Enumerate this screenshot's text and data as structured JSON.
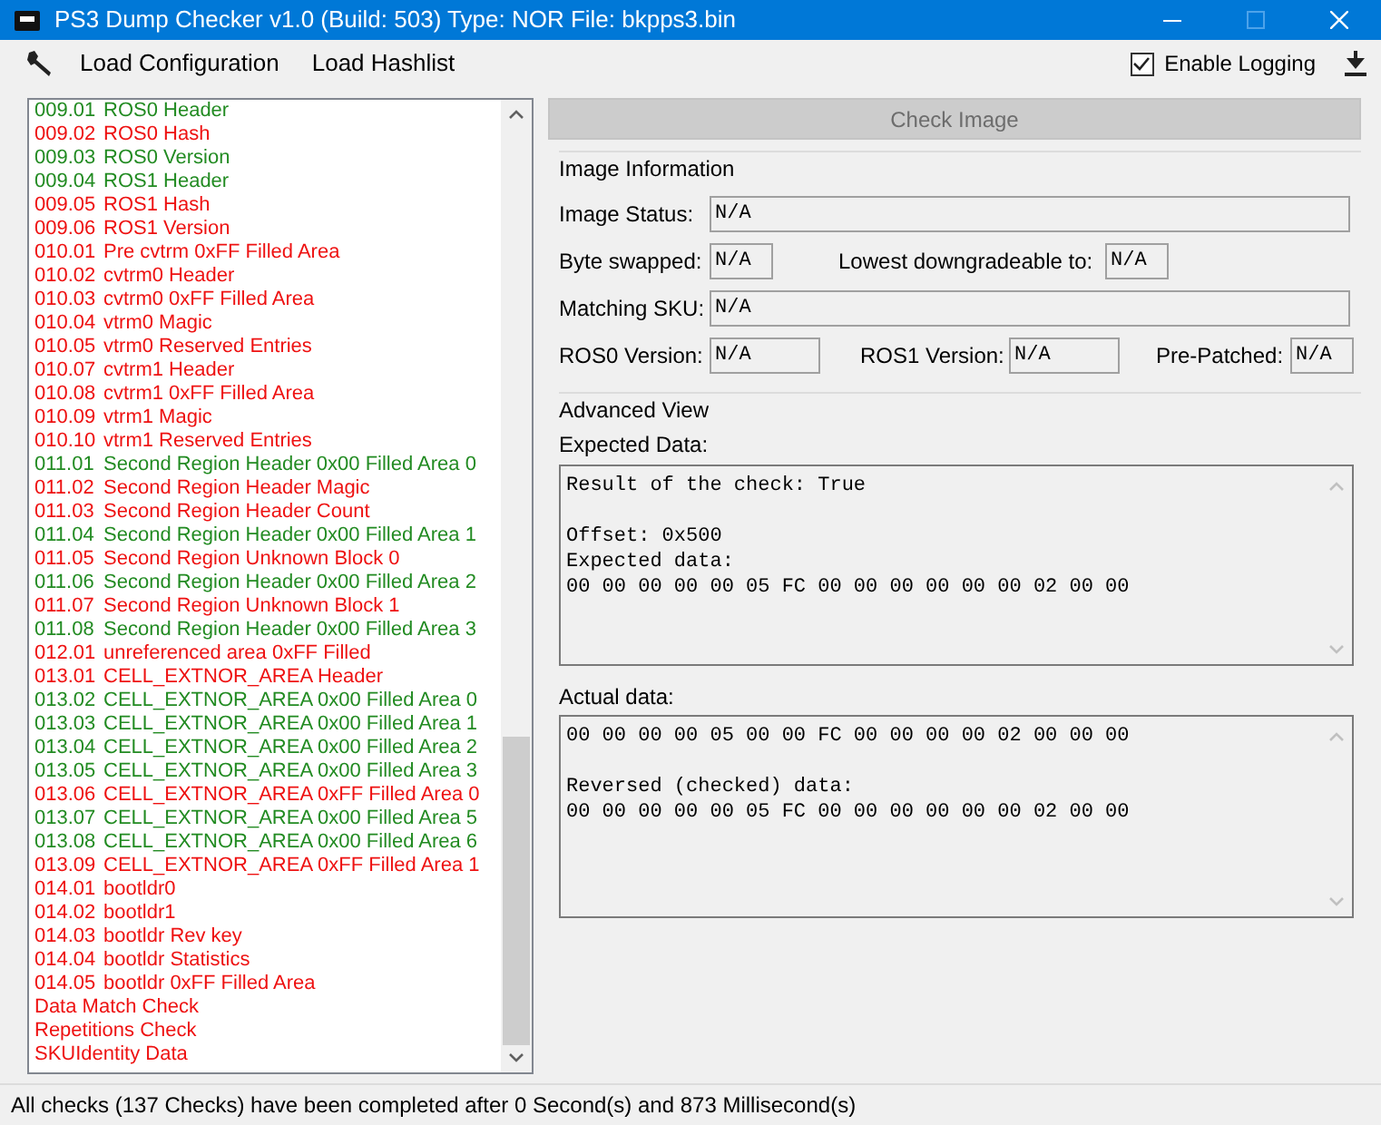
{
  "window": {
    "title": "PS3 Dump Checker v1.0 (Build: 503) Type: NOR File: bkpps3.bin"
  },
  "toolbar": {
    "items": [
      "Load Configuration",
      "Load Hashlist"
    ],
    "logging": {
      "label": "Enable Logging",
      "checked": true
    }
  },
  "checks": [
    {
      "code": "009.01",
      "label": "ROS0 Header",
      "color": "#228b22"
    },
    {
      "code": "009.02",
      "label": "ROS0 Hash",
      "color": "#ee1111"
    },
    {
      "code": "009.03",
      "label": "ROS0 Version",
      "color": "#228b22"
    },
    {
      "code": "009.04",
      "label": "ROS1 Header",
      "color": "#228b22"
    },
    {
      "code": "009.05",
      "label": "ROS1 Hash",
      "color": "#ee1111"
    },
    {
      "code": "009.06",
      "label": "ROS1 Version",
      "color": "#ee1111"
    },
    {
      "code": "010.01",
      "label": "Pre cvtrm 0xFF Filled Area",
      "color": "#ee1111"
    },
    {
      "code": "010.02",
      "label": "cvtrm0 Header",
      "color": "#ee1111"
    },
    {
      "code": "010.03",
      "label": "cvtrm0 0xFF Filled Area",
      "color": "#ee1111"
    },
    {
      "code": "010.04",
      "label": "vtrm0 Magic",
      "color": "#ee1111"
    },
    {
      "code": "010.05",
      "label": "vtrm0 Reserved Entries",
      "color": "#ee1111"
    },
    {
      "code": "010.07",
      "label": "cvtrm1 Header",
      "color": "#ee1111"
    },
    {
      "code": "010.08",
      "label": "cvtrm1 0xFF Filled Area",
      "color": "#ee1111"
    },
    {
      "code": "010.09",
      "label": "vtrm1 Magic",
      "color": "#ee1111"
    },
    {
      "code": "010.10",
      "label": "vtrm1 Reserved Entries",
      "color": "#ee1111"
    },
    {
      "code": "011.01",
      "label": "Second Region Header 0x00 Filled Area 0",
      "color": "#228b22"
    },
    {
      "code": "011.02",
      "label": "Second Region Header Magic",
      "color": "#ee1111"
    },
    {
      "code": "011.03",
      "label": "Second Region Header Count",
      "color": "#ee1111"
    },
    {
      "code": "011.04",
      "label": "Second Region Header 0x00 Filled Area 1",
      "color": "#228b22"
    },
    {
      "code": "011.05",
      "label": "Second Region Unknown Block 0",
      "color": "#ee1111"
    },
    {
      "code": "011.06",
      "label": "Second Region Header 0x00 Filled Area 2",
      "color": "#228b22"
    },
    {
      "code": "011.07",
      "label": "Second Region Unknown Block 1",
      "color": "#ee1111"
    },
    {
      "code": "011.08",
      "label": "Second Region Header 0x00 Filled Area 3",
      "color": "#228b22"
    },
    {
      "code": "012.01",
      "label": "unreferenced area 0xFF Filled",
      "color": "#ee1111"
    },
    {
      "code": "013.01",
      "label": "CELL_EXTNOR_AREA Header",
      "color": "#ee1111"
    },
    {
      "code": "013.02",
      "label": "CELL_EXTNOR_AREA 0x00 Filled Area 0",
      "color": "#228b22"
    },
    {
      "code": "013.03",
      "label": "CELL_EXTNOR_AREA 0x00 Filled Area 1",
      "color": "#228b22"
    },
    {
      "code": "013.04",
      "label": "CELL_EXTNOR_AREA 0x00 Filled Area 2",
      "color": "#228b22"
    },
    {
      "code": "013.05",
      "label": "CELL_EXTNOR_AREA 0x00 Filled Area 3",
      "color": "#228b22"
    },
    {
      "code": "013.06",
      "label": "CELL_EXTNOR_AREA 0xFF Filled Area 0",
      "color": "#ee1111"
    },
    {
      "code": "013.07",
      "label": "CELL_EXTNOR_AREA 0x00 Filled Area 5",
      "color": "#228b22"
    },
    {
      "code": "013.08",
      "label": "CELL_EXTNOR_AREA 0x00 Filled Area 6",
      "color": "#228b22"
    },
    {
      "code": "013.09",
      "label": "CELL_EXTNOR_AREA 0xFF Filled Area 1",
      "color": "#ee1111"
    },
    {
      "code": "014.01",
      "label": "bootldr0",
      "color": "#ee1111"
    },
    {
      "code": "014.02",
      "label": "bootldr1",
      "color": "#ee1111"
    },
    {
      "code": "014.03",
      "label": "bootldr Rev key",
      "color": "#ee1111"
    },
    {
      "code": "014.04",
      "label": "bootldr Statistics",
      "color": "#ee1111"
    },
    {
      "code": "014.05",
      "label": "bootldr 0xFF Filled Area",
      "color": "#ee1111"
    },
    {
      "label": "Data Match Check",
      "color": "#ee1111"
    },
    {
      "label": "Repetitions Check",
      "color": "#ee1111"
    },
    {
      "label": "SKUIdentity Data",
      "color": "#ee1111"
    }
  ],
  "check_button": "Check Image",
  "image_information": {
    "title": "Image Information",
    "image_status": {
      "label": "Image Status:",
      "value": "N/A"
    },
    "byte_swapped": {
      "label": "Byte swapped:",
      "value": "N/A"
    },
    "lowest_downgradeable": {
      "label": "Lowest downgradeable to:",
      "value": "N/A"
    },
    "matching_sku": {
      "label": "Matching SKU:",
      "value": "N/A"
    },
    "ros0_version": {
      "label": "ROS0 Version:",
      "value": "N/A"
    },
    "ros1_version": {
      "label": "ROS1 Version:",
      "value": "N/A"
    },
    "pre_patched": {
      "label": "Pre-Patched:",
      "value": "N/A"
    }
  },
  "advanced_view": {
    "title": "Advanced View",
    "expected": {
      "label": "Expected Data:",
      "text": "Result of the check: True\n\nOffset: 0x500\nExpected data:\n00 00 00 00 00 05 FC 00 00 00 00 00 00 02 00 00"
    },
    "actual": {
      "label": "Actual data:",
      "text": "00 00 00 00 05 00 00 FC 00 00 00 00 02 00 00 00\n\nReversed (checked) data:\n00 00 00 00 00 05 FC 00 00 00 00 00 00 02 00 00"
    }
  },
  "status_bar": "All checks (137 Checks) have been completed after 0 Second(s) and 873 Millisecond(s)"
}
